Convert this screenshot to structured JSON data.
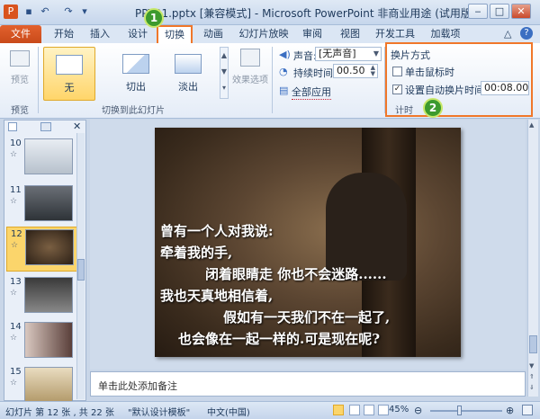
{
  "window": {
    "title": "PPT01.pptx [兼容模式] - Microsoft PowerPoint 非商业用途 (试用版)"
  },
  "ribbon_tabs": [
    "文件",
    "开始",
    "插入",
    "设计",
    "切换",
    "动画",
    "幻灯片放映",
    "审阅",
    "视图",
    "开发工具",
    "加载项"
  ],
  "ribbon": {
    "preview": {
      "label": "预览",
      "group": "预览"
    },
    "transitions": {
      "group": "切换到此幻灯片",
      "items": [
        "无",
        "切出",
        "淡出"
      ],
      "effect_options": "效果选项"
    },
    "sound": {
      "label": "声音:",
      "value": "[无声音]"
    },
    "duration": {
      "label": "持续时间:",
      "value": "00.50"
    },
    "apply_all": "全部应用",
    "timing": {
      "group": "计时",
      "title": "换片方式",
      "on_click": "单击鼠标时",
      "auto_after": "设置自动换片时间:",
      "auto_value": "00:08.00"
    }
  },
  "annotations": {
    "badge1": "1",
    "badge2": "2"
  },
  "slides_panel": {
    "slides": [
      {
        "num": "10"
      },
      {
        "num": "11"
      },
      {
        "num": "12"
      },
      {
        "num": "13"
      },
      {
        "num": "14"
      },
      {
        "num": "15"
      }
    ]
  },
  "slide": {
    "lines": [
      "曾有一个人对我说:",
      "牵着我的手,",
      "闭着眼睛走 你也不会迷路......",
      "我也天真地相信着,",
      "假如有一天我们不在一起了,",
      "也会像在一起一样的.可是现在呢?"
    ]
  },
  "notes": {
    "placeholder": "单击此处添加备注"
  },
  "status": {
    "slide_info": "幻灯片 第 12 张 , 共 22 张",
    "theme": "\"默认设计模板\"",
    "language": "中文(中国)",
    "zoom": "45%"
  }
}
